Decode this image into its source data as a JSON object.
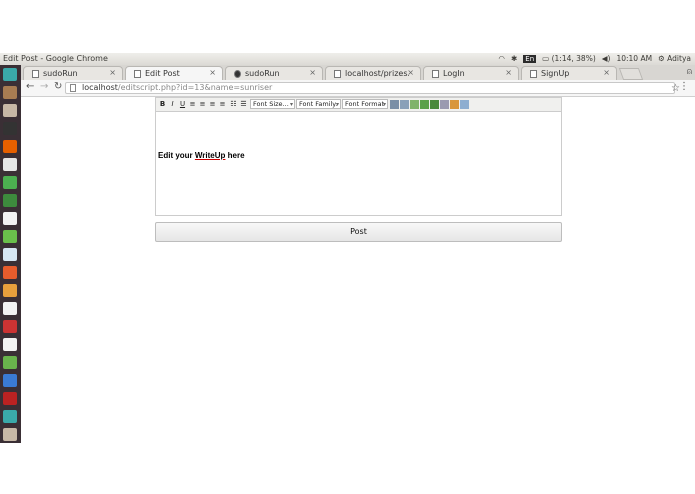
{
  "os_panel": {
    "window_title": "Edit Post - Google Chrome",
    "keyboard": "En",
    "battery": "(1:14, 38%)",
    "clock": "10:10 AM",
    "user": "Aditya"
  },
  "tabs": [
    {
      "label": "sudoRun",
      "icon": "page-icon"
    },
    {
      "label": "Edit Post",
      "icon": "page-icon",
      "active": true
    },
    {
      "label": "sudoRun",
      "icon": "github-icon"
    },
    {
      "label": "localhost/prizes.h",
      "icon": "page-icon"
    },
    {
      "label": "LogIn",
      "icon": "page-icon"
    },
    {
      "label": "SignUp",
      "icon": "page-icon"
    }
  ],
  "toolbar": {
    "url_host": "localhost",
    "url_rest": "/editscript.php?id=13&name=sunriser"
  },
  "editor": {
    "font_size_placeholder": "Font Size...",
    "font_family_placeholder": "Font Family.",
    "font_format_placeholder": "Font Format",
    "content_prefix": "Edit your ",
    "content_misspelled": "WriteUp",
    "content_suffix": " here"
  },
  "post_label": "Post",
  "colors": {
    "launcher_bg": "#3a2f35",
    "panel_bg": "#dcdad5",
    "accent": "#dd4814"
  }
}
